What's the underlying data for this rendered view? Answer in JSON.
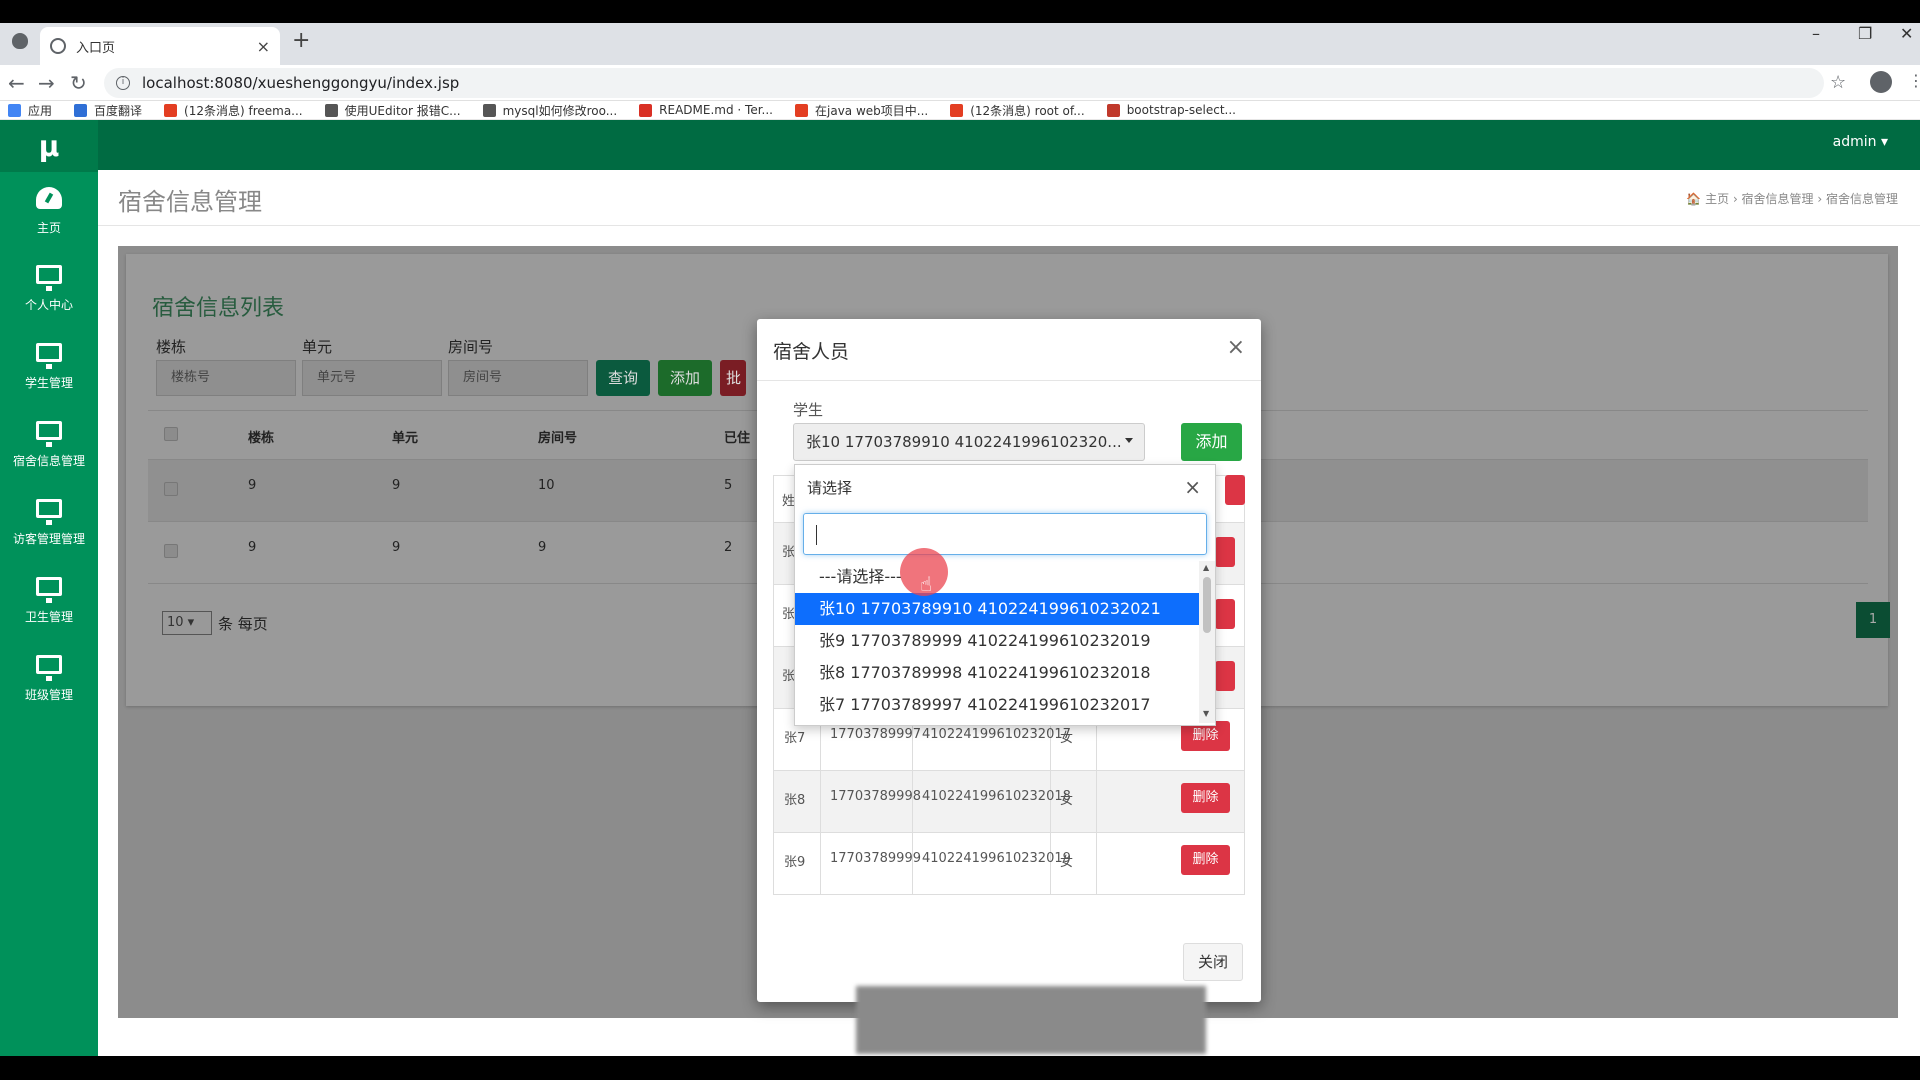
{
  "browser": {
    "tab_title": "入口页",
    "url": "localhost:8080/xueshenggongyu/index.jsp",
    "bookmarks": [
      {
        "label": "应用",
        "color": "#4285f4"
      },
      {
        "label": "百度翻译",
        "color": "#2f6fd6"
      },
      {
        "label": "(12条消息) freema...",
        "color": "#e33e22"
      },
      {
        "label": "使用UEditor 报错C...",
        "color": "#555555"
      },
      {
        "label": "mysql如何修改roo...",
        "color": "#555555"
      },
      {
        "label": "README.md · Ter...",
        "color": "#d93025"
      },
      {
        "label": "在java web项目中...",
        "color": "#e33e22"
      },
      {
        "label": "(12条消息) root of...",
        "color": "#e33e22"
      },
      {
        "label": "bootstrap-select...",
        "color": "#c0392b"
      }
    ]
  },
  "app": {
    "logo": "μ",
    "user": "admin ▾",
    "page_title": "宿舍信息管理",
    "breadcrumb": "🏠 主页  ›  宿舍信息管理  ›  宿舍信息管理",
    "sidebar": [
      {
        "label": "主页",
        "icon": "dashboard-icon"
      },
      {
        "label": "个人中心",
        "icon": "monitor-icon"
      },
      {
        "label": "学生管理",
        "icon": "monitor-icon"
      },
      {
        "label": "宿舍信息管理",
        "icon": "monitor-icon"
      },
      {
        "label": "访客管理管理",
        "icon": "monitor-icon"
      },
      {
        "label": "卫生管理",
        "icon": "monitor-icon"
      },
      {
        "label": "班级管理",
        "icon": "monitor-icon"
      }
    ]
  },
  "list": {
    "title": "宿舍信息列表",
    "filters": {
      "building_label": "楼栋",
      "building_ph": "楼栋号",
      "unit_label": "单元",
      "unit_ph": "单元号",
      "room_label": "房间号",
      "room_ph": "房间号"
    },
    "buttons": {
      "query": "查询",
      "add": "添加",
      "batch": "批"
    },
    "headers": [
      "楼栋",
      "单元",
      "房间号",
      "已住"
    ],
    "rows": [
      [
        "9",
        "9",
        "10",
        "5"
      ],
      [
        "9",
        "9",
        "9",
        "2"
      ]
    ],
    "page_size": "10 ▾",
    "per_page_text": "条 每页",
    "current_page": "1"
  },
  "modal": {
    "title": "宿舍人员",
    "close_x": "×",
    "student_label": "学生",
    "student_selected": "张10 17703789910 4102241996102320...",
    "add_button": "添加",
    "close_button": "关闭",
    "partial_header": "姓",
    "partial_rows": [
      "张",
      "张",
      "张"
    ],
    "rows": [
      {
        "name": "张7",
        "phone": "17703789997",
        "id": "410224199610232017",
        "gender": "女",
        "action": "删除"
      },
      {
        "name": "张8",
        "phone": "17703789998",
        "id": "410224199610232018",
        "gender": "女",
        "action": "删除"
      },
      {
        "name": "张9",
        "phone": "17703789999",
        "id": "410224199610232019",
        "gender": "女",
        "action": "删除"
      }
    ]
  },
  "dropdown": {
    "header": "请选择",
    "close_x": "×",
    "options": [
      "---请选择---",
      "张10 17703789910 410224199610232021",
      "张9 17703789999 410224199610232019",
      "张8 17703789998 410224199610232018",
      "张7 17703789997 410224199610232017"
    ],
    "selected_index": 1
  }
}
